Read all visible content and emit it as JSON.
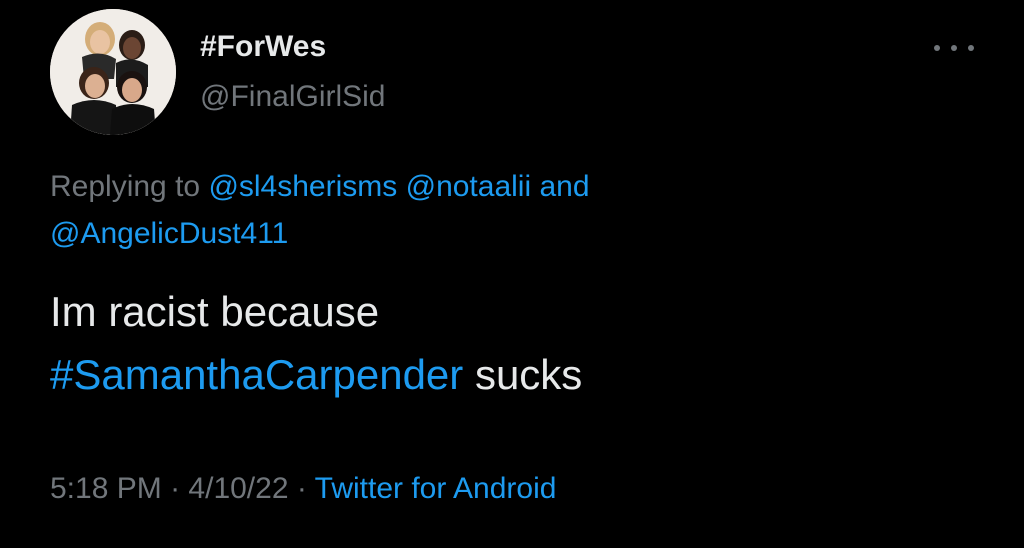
{
  "tweet": {
    "display_name": "#ForWes",
    "handle": "@FinalGirlSid",
    "more_label": "More",
    "replying": {
      "prefix": "Replying to",
      "mention1": "@sl4sherisms",
      "mention2": "@notaalii",
      "conjunction": "and",
      "mention3": "@AngelicDust411"
    },
    "text": {
      "line1": "Im racist because",
      "hashtag": "#SamanthaCarpender",
      "suffix": "sucks"
    },
    "meta": {
      "time": "5:18 PM",
      "separator": "·",
      "date": "4/10/22",
      "source": "Twitter for Android"
    }
  },
  "colors": {
    "background": "#000000",
    "text_primary": "#e7e9ea",
    "text_secondary": "#71767b",
    "link": "#1d9bf0"
  },
  "icons": {
    "more": "more-horizontal-icon",
    "avatar": "profile-photo"
  }
}
